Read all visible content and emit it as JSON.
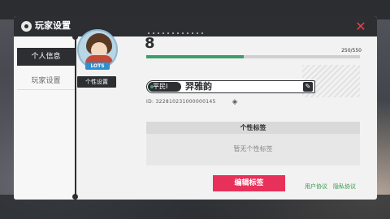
{
  "dialog": {
    "title": "玩家设置",
    "close_icon": "close-x-icon",
    "accent_color": "#e8315a"
  },
  "tabs": [
    {
      "label": "个人信息",
      "active": true
    },
    {
      "label": "玩家设置",
      "active": false
    }
  ],
  "profile": {
    "avatar_badge": "LOTS",
    "personalize_label": "个性设置",
    "level": "8",
    "exp_text": "250/550",
    "exp_progress": 0.455,
    "rank_label": "平民I",
    "player_name": "羿雅韵",
    "id_text": "ID: 322810231000000145"
  },
  "tags": {
    "header": "个性标签",
    "empty_text": "暂无个性标签",
    "edit_button": "编辑标签"
  },
  "links": {
    "user_agreement": "用户协议",
    "privacy_policy": "隐私协议"
  }
}
